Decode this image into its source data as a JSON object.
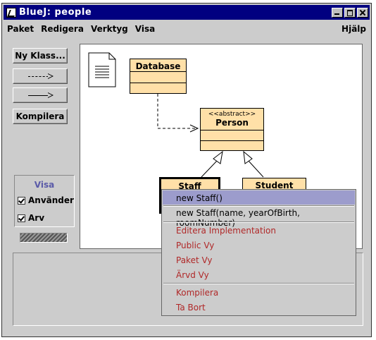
{
  "window": {
    "title": "BlueJ:  people"
  },
  "menubar": {
    "items": [
      "Paket",
      "Redigera",
      "Verktyg",
      "Visa"
    ],
    "help": "Hjälp"
  },
  "toolbar": {
    "new_class": "Ny Klass...",
    "compile": "Kompilera"
  },
  "visa_panel": {
    "title": "Visa",
    "uses": "Använder",
    "inheritance": "Arv",
    "uses_checked": true,
    "inheritance_checked": true
  },
  "classes": {
    "database": "Database",
    "person": {
      "stereotype": "<<abstract>>",
      "name": "Person"
    },
    "staff": "Staff",
    "student": "Student"
  },
  "context_menu": {
    "constructors": [
      "new Staff()",
      "new Staff(name, yearOfBirth, roomNumber)"
    ],
    "edit_group": [
      "Editera Implementation",
      "Public Vy",
      "Paket Vy",
      "Ärvd Vy"
    ],
    "action_group": [
      "Kompilera",
      "Ta Bort"
    ],
    "selected_index": 0,
    "item_color": "#b02828",
    "highlight_color": "#9c9ccc"
  },
  "colors": {
    "titlebar": "#010080",
    "class_fill": "#ffe0a8",
    "window_bg": "#cccccc"
  }
}
